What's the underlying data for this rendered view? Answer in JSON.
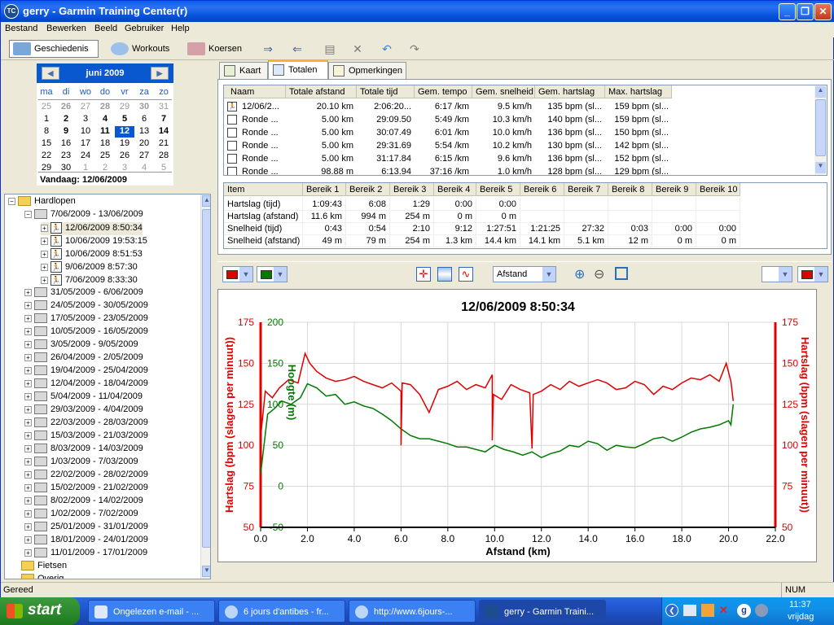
{
  "window": {
    "title": "gerry - Garmin Training Center(r)",
    "icon": "TC"
  },
  "menu": [
    "Bestand",
    "Bewerken",
    "Beeld",
    "Gebruiker",
    "Help"
  ],
  "toolbar": {
    "history": "Geschiedenis",
    "workouts": "Workouts",
    "courses": "Koersen"
  },
  "calendar": {
    "month": "juni 2009",
    "weekdays": [
      "ma",
      "di",
      "wo",
      "do",
      "vr",
      "za",
      "zo"
    ],
    "weeks": [
      [
        "25",
        "26",
        "27",
        "28",
        "29",
        "30",
        "31"
      ],
      [
        "1",
        "2",
        "3",
        "4",
        "5",
        "6",
        "7"
      ],
      [
        "8",
        "9",
        "10",
        "11",
        "12",
        "13",
        "14"
      ],
      [
        "15",
        "16",
        "17",
        "18",
        "19",
        "20",
        "21"
      ],
      [
        "22",
        "23",
        "24",
        "25",
        "26",
        "27",
        "28"
      ],
      [
        "29",
        "30",
        "1",
        "2",
        "3",
        "4",
        "5"
      ]
    ],
    "selected": "12",
    "today_label": "Vandaag: 12/06/2009"
  },
  "tree": {
    "root": "Hardlopen",
    "open_week": "7/06/2009 - 13/06/2009",
    "activities": [
      "12/06/2009 8:50:34",
      "10/06/2009 19:53:15",
      "10/06/2009 8:51:53",
      "9/06/2009 8:57:30",
      "7/06/2009 8:33:30"
    ],
    "weeks": [
      "31/05/2009 - 6/06/2009",
      "24/05/2009 - 30/05/2009",
      "17/05/2009 - 23/05/2009",
      "10/05/2009 - 16/05/2009",
      "3/05/2009 - 9/05/2009",
      "26/04/2009 - 2/05/2009",
      "19/04/2009 - 25/04/2009",
      "12/04/2009 - 18/04/2009",
      "5/04/2009 - 11/04/2009",
      "29/03/2009 - 4/04/2009",
      "22/03/2009 - 28/03/2009",
      "15/03/2009 - 21/03/2009",
      "8/03/2009 - 14/03/2009",
      "1/03/2009 - 7/03/2009",
      "22/02/2009 - 28/02/2009",
      "15/02/2009 - 21/02/2009",
      "8/02/2009 - 14/02/2009",
      "1/02/2009 - 7/02/2009",
      "25/01/2009 - 31/01/2009",
      "18/01/2009 - 24/01/2009",
      "11/01/2009 - 17/01/2009"
    ],
    "folders": [
      "Fietsen",
      "Overig"
    ]
  },
  "tabs": [
    "Kaart",
    "Totalen",
    "Opmerkingen"
  ],
  "laps": {
    "headers": [
      "Naam",
      "Totale afstand",
      "Totale tijd",
      "Gem. tempo",
      "Gem. snelheid",
      "Gem. hartslag",
      "Max. hartslag"
    ],
    "rows": [
      [
        "12/06/2...",
        "20.10 km",
        "2:06:20...",
        "6:17 /km",
        "9.5 km/h",
        "135 bpm (sl...",
        "159 bpm (sl..."
      ],
      [
        "Ronde ...",
        "5.00 km",
        "29:09.50",
        "5:49 /km",
        "10.3 km/h",
        "140 bpm (sl...",
        "159 bpm (sl..."
      ],
      [
        "Ronde ...",
        "5.00 km",
        "30:07.49",
        "6:01 /km",
        "10.0 km/h",
        "136 bpm (sl...",
        "150 bpm (sl..."
      ],
      [
        "Ronde ...",
        "5.00 km",
        "29:31.69",
        "5:54 /km",
        "10.2 km/h",
        "130 bpm (sl...",
        "142 bpm (sl..."
      ],
      [
        "Ronde ...",
        "5.00 km",
        "31:17.84",
        "6:15 /km",
        "9.6 km/h",
        "136 bpm (sl...",
        "152 bpm (sl..."
      ],
      [
        "Ronde ...",
        "98.88 m",
        "6:13.94",
        "37:16 /km",
        "1.0 km/h",
        "128 bpm (sl...",
        "129 bpm (sl..."
      ]
    ]
  },
  "zones": {
    "headers": [
      "Item",
      "Bereik 1",
      "Bereik 2",
      "Bereik 3",
      "Bereik 4",
      "Bereik 5",
      "Bereik 6",
      "Bereik 7",
      "Bereik 8",
      "Bereik 9",
      "Bereik 10"
    ],
    "rows": [
      [
        "Hartslag (tijd)",
        "1:09:43",
        "6:08",
        "1:29",
        "0:00",
        "0:00",
        "",
        "",
        "",
        "",
        ""
      ],
      [
        "Hartslag (afstand)",
        "11.6 km",
        "994 m",
        "254 m",
        "0 m",
        "0 m",
        "",
        "",
        "",
        "",
        ""
      ],
      [
        "Snelheid (tijd)",
        "0:43",
        "0:54",
        "2:10",
        "9:12",
        "1:27:51",
        "1:21:25",
        "27:32",
        "0:03",
        "0:00",
        "0:00"
      ],
      [
        "Snelheid (afstand)",
        "49 m",
        "79 m",
        "254 m",
        "1.3 km",
        "14.4 km",
        "14.1 km",
        "5.1 km",
        "12 m",
        "0 m",
        "0 m"
      ]
    ]
  },
  "chart_controls": {
    "x_axis_select": "Afstand"
  },
  "chart_data": {
    "type": "line",
    "title": "12/06/2009 8:50:34",
    "xlabel": "Afstand (km)",
    "ylabel_left": "Hartslag (bpm (slagen per minuut))",
    "ylabel_left_inner": "Hoogte (m)",
    "ylabel_right": "Hartslag (bpm (slagen per minuut))",
    "xlim": [
      0,
      22
    ],
    "xticks": [
      "0.0",
      "2.0",
      "4.0",
      "6.0",
      "8.0",
      "10.0",
      "12.0",
      "14.0",
      "16.0",
      "18.0",
      "20.0",
      "22.0"
    ],
    "ylim_hr": [
      50,
      175
    ],
    "yticks_hr": [
      "175",
      "150",
      "125",
      "100",
      "75",
      "50"
    ],
    "ylim_alt": [
      -50,
      200
    ],
    "yticks_alt": [
      "200",
      "150",
      "100",
      "50",
      "0",
      "-50"
    ],
    "colors": {
      "hr": "#E00000",
      "alt": "#007A00"
    },
    "series": [
      {
        "name": "Hartslag",
        "x": [
          0,
          0.2,
          0.5,
          0.8,
          1.2,
          1.6,
          1.9,
          2.1,
          2.4,
          2.8,
          3.2,
          3.6,
          4.0,
          4.4,
          4.8,
          5.2,
          5.6,
          6.0,
          6.0,
          6.05,
          6.4,
          6.8,
          7.2,
          7.6,
          8.0,
          8.4,
          8.8,
          9.2,
          9.6,
          9.9,
          9.9,
          9.95,
          10.3,
          10.7,
          11.1,
          11.5,
          11.6,
          11.65,
          12.0,
          12.4,
          12.8,
          13.2,
          13.6,
          14.0,
          14.4,
          14.8,
          15.2,
          15.6,
          16.0,
          16.4,
          16.8,
          17.2,
          17.6,
          18.0,
          18.4,
          18.8,
          19.2,
          19.6,
          19.9,
          20.1,
          20.2
        ],
        "y": [
          105,
          133,
          129,
          135,
          140,
          138,
          156,
          150,
          145,
          141,
          139,
          140,
          142,
          139,
          137,
          135,
          138,
          133,
          100,
          138,
          137,
          131,
          120,
          134,
          136,
          139,
          134,
          137,
          135,
          143,
          103,
          131,
          128,
          137,
          134,
          132,
          98,
          131,
          133,
          137,
          134,
          139,
          136,
          138,
          140,
          138,
          134,
          135,
          139,
          137,
          131,
          136,
          134,
          138,
          141,
          140,
          143,
          139,
          150,
          139,
          127
        ]
      },
      {
        "name": "Hoogte",
        "x": [
          0,
          0.3,
          0.6,
          0.9,
          1.3,
          1.7,
          2.0,
          2.4,
          2.8,
          3.2,
          3.6,
          4.0,
          4.4,
          4.8,
          5.2,
          5.6,
          6.0,
          6.4,
          6.8,
          7.2,
          7.6,
          8.0,
          8.4,
          8.8,
          9.2,
          9.6,
          10.0,
          10.4,
          10.8,
          11.2,
          11.6,
          12.0,
          12.4,
          12.8,
          13.2,
          13.6,
          14.0,
          14.4,
          14.8,
          15.2,
          15.6,
          16.0,
          16.4,
          16.8,
          17.2,
          17.6,
          18.0,
          18.4,
          18.8,
          19.2,
          19.6,
          20.0,
          20.1,
          20.2
        ],
        "y": [
          15,
          88,
          95,
          104,
          100,
          108,
          125,
          120,
          110,
          112,
          100,
          103,
          98,
          95,
          88,
          80,
          70,
          62,
          58,
          58,
          55,
          52,
          48,
          48,
          45,
          42,
          50,
          45,
          42,
          38,
          42,
          35,
          40,
          43,
          50,
          48,
          55,
          52,
          44,
          50,
          48,
          47,
          52,
          58,
          60,
          55,
          60,
          66,
          70,
          72,
          75,
          80,
          75,
          100
        ]
      }
    ]
  },
  "status": {
    "left": "Gereed",
    "num": "NUM"
  },
  "taskbar": {
    "start": "start",
    "tasks": [
      "Ongelezen e-mail - ...",
      "6 jours d'antibes - fr...",
      "http://www.6jours-...",
      "gerry - Garmin Traini..."
    ],
    "clock": "11:37",
    "day": "vrijdag"
  }
}
